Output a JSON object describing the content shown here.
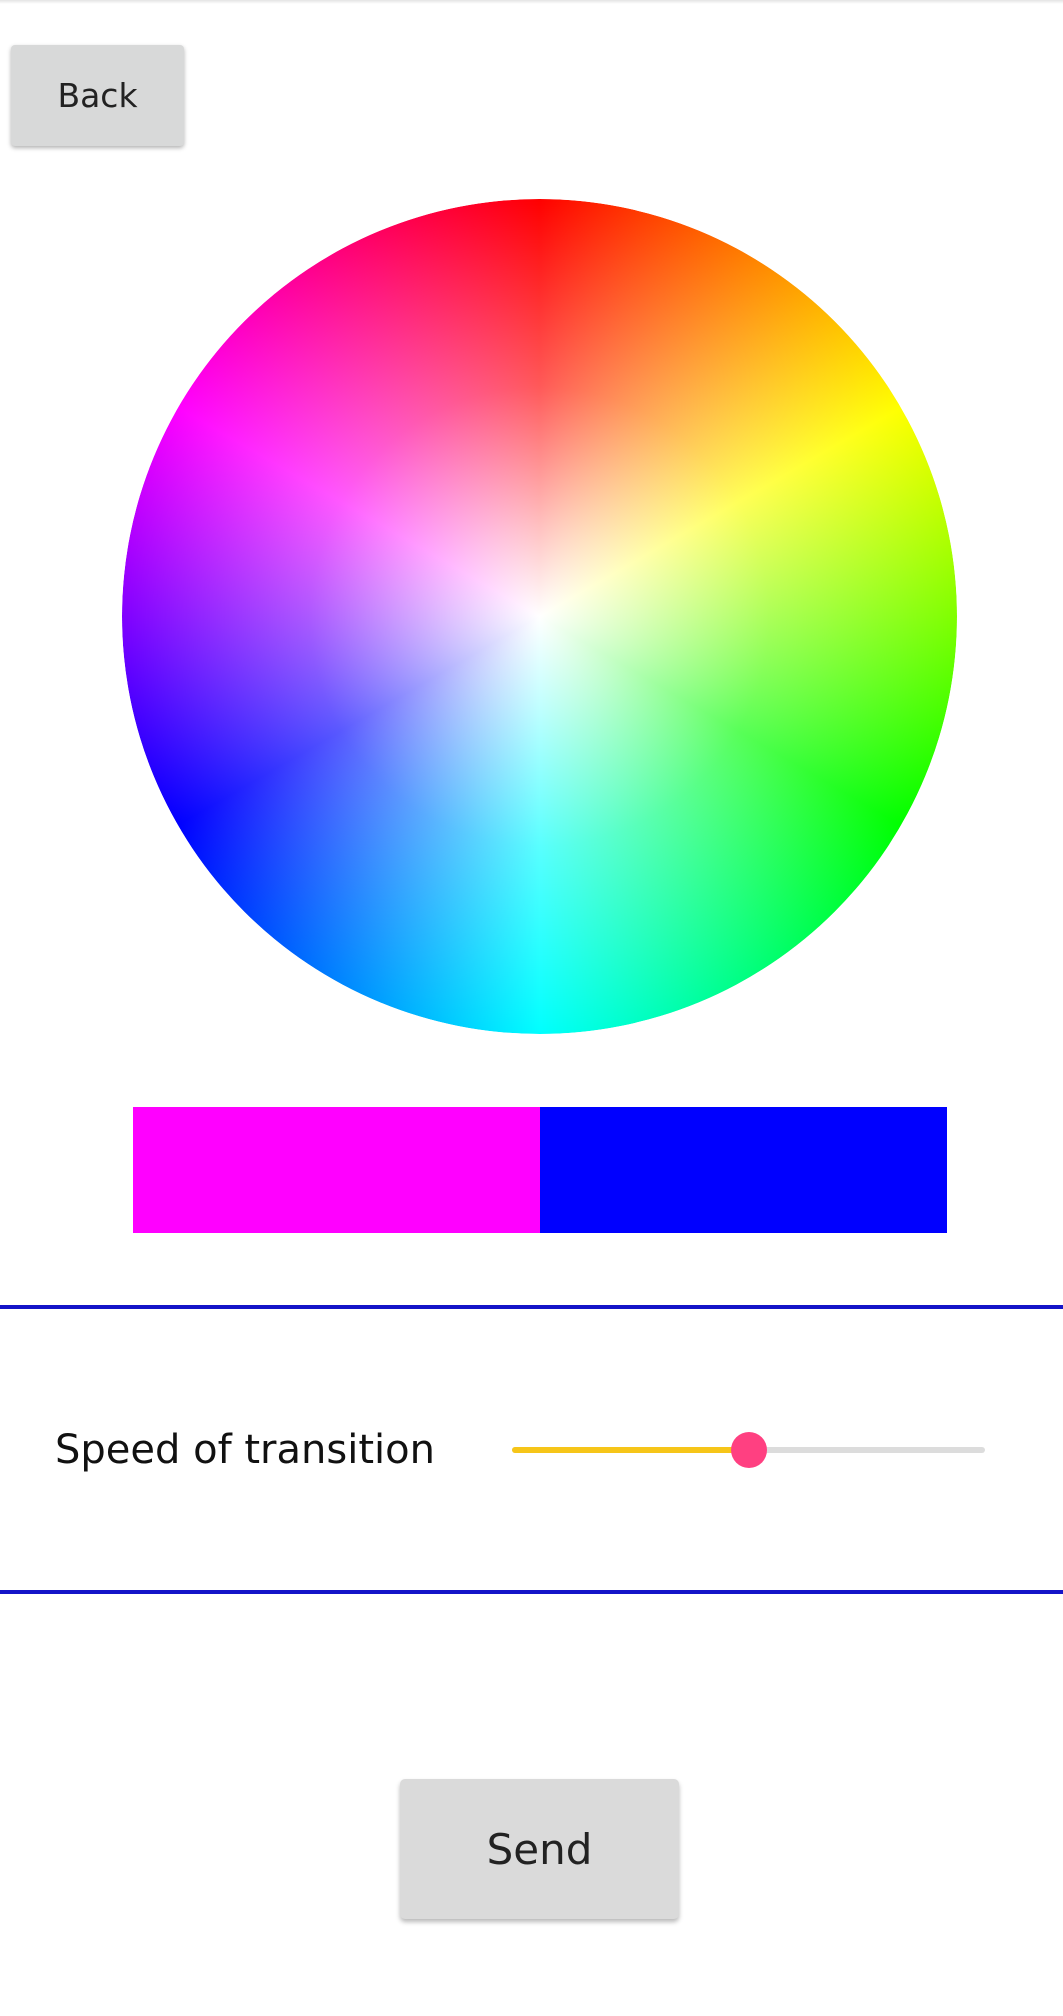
{
  "header": {
    "back_label": "Back"
  },
  "color_wheel": {
    "icon": "color-wheel",
    "hue_stops": [
      "#ff0000",
      "#ffff00",
      "#00ff00",
      "#00ffff",
      "#0000ff",
      "#ff00ff"
    ]
  },
  "swatches": [
    {
      "color": "#ff00ff"
    },
    {
      "color": "#0000ff"
    }
  ],
  "divider_color": "#1414c8",
  "speed": {
    "label": "Speed of transition",
    "value_fraction": 0.5,
    "track_color": "#dcdcdc",
    "fill_color": "#f6c518",
    "thumb_color": "#ff4081"
  },
  "footer": {
    "send_label": "Send"
  }
}
